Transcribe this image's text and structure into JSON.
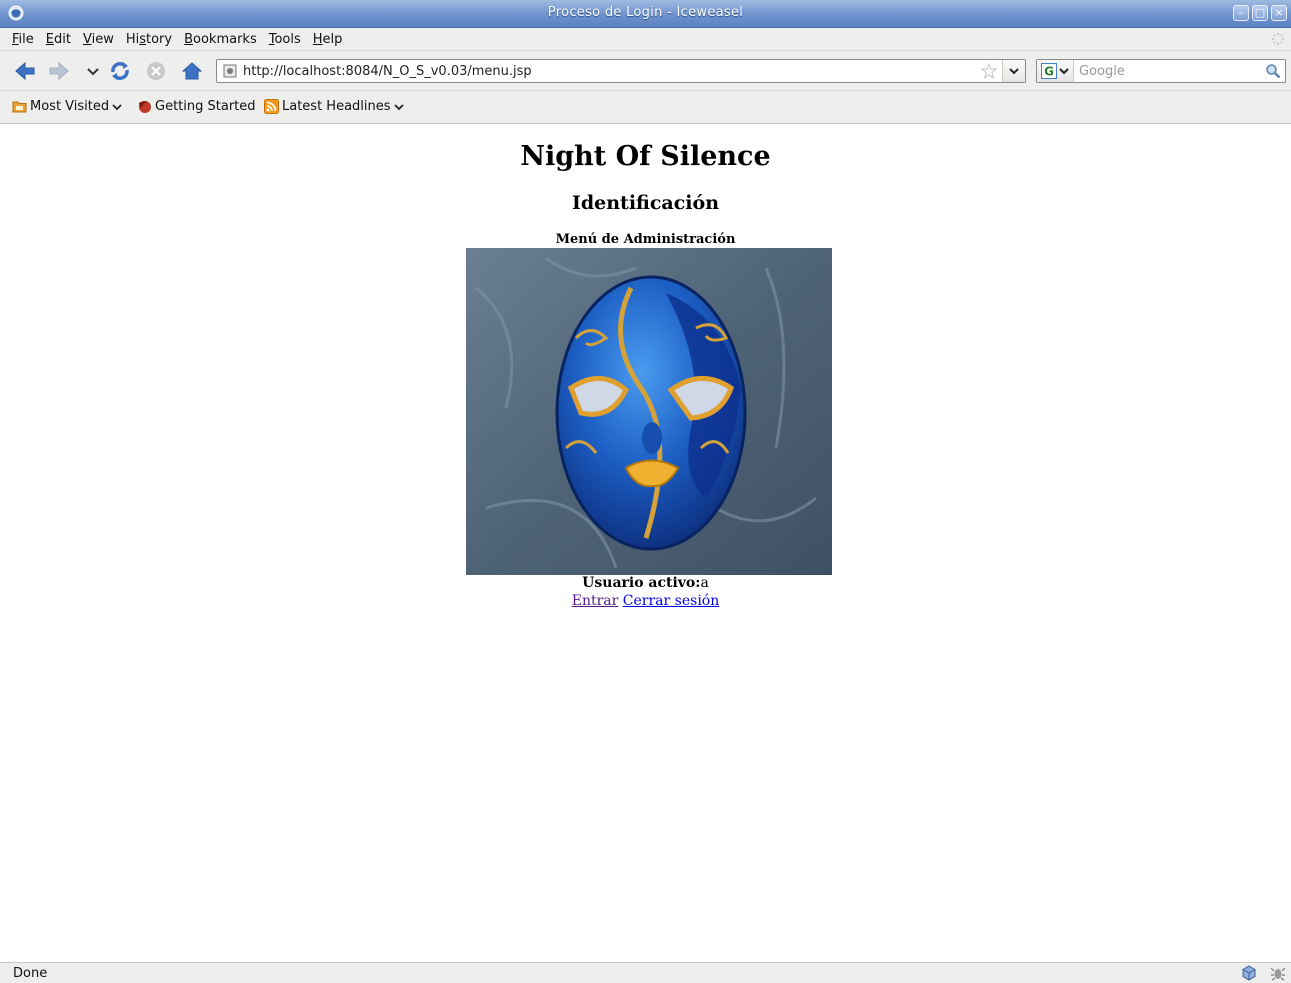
{
  "window": {
    "title": "Proceso de Login - Iceweasel",
    "controls": [
      "minimize-icon",
      "maximize-icon",
      "close-icon"
    ]
  },
  "menubar": {
    "items": [
      {
        "label": "File",
        "accel": "F"
      },
      {
        "label": "Edit",
        "accel": "E"
      },
      {
        "label": "View",
        "accel": "V"
      },
      {
        "label": "History",
        "accel": "s"
      },
      {
        "label": "Bookmarks",
        "accel": "B"
      },
      {
        "label": "Tools",
        "accel": "T"
      },
      {
        "label": "Help",
        "accel": "H"
      }
    ]
  },
  "navbar": {
    "url": "http://localhost:8084/N_O_S_v0.03/menu.jsp",
    "search_placeholder": "Google"
  },
  "bookmarks": {
    "items": [
      {
        "label": "Most Visited",
        "icon": "folder-icon",
        "dropdown": true
      },
      {
        "label": "Getting Started",
        "icon": "firefox-icon",
        "dropdown": false
      },
      {
        "label": "Latest Headlines",
        "icon": "rss-icon",
        "dropdown": true
      }
    ]
  },
  "page": {
    "title": "Night Of Silence",
    "subtitle": "Identificación",
    "section": "Menú de Administración",
    "image": "blue-venetian-mask",
    "user_label": "Usuario activo:",
    "user_value": "a",
    "links": {
      "enter": "Entrar",
      "logout": "Cerrar sesión"
    }
  },
  "status": {
    "text": "Done"
  },
  "colors": {
    "titlebar": "#6e92cc",
    "chrome": "#eeeeec",
    "link": "#0000ee",
    "visited_link": "#551a8b"
  }
}
